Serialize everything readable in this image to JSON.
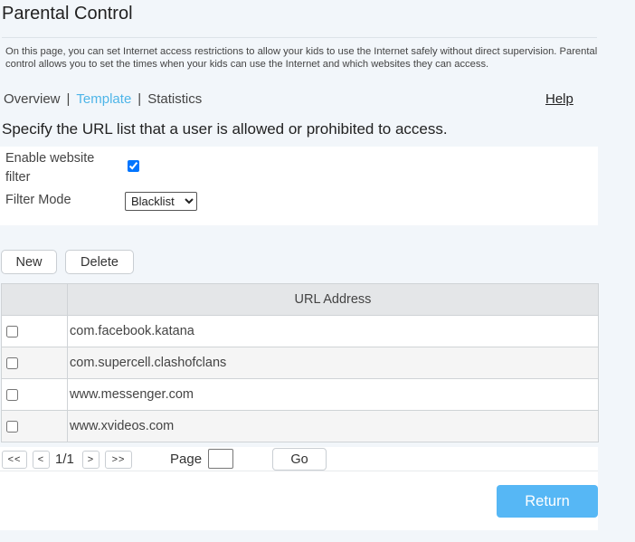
{
  "page": {
    "title": "Parental Control",
    "description": "On this page, you can set Internet access restrictions to allow your kids to use the Internet safely without direct supervision. Parental control allows you to set the times when your kids can use the Internet and which websites they can access."
  },
  "nav": {
    "tabs": [
      {
        "label": "Overview",
        "active": false
      },
      {
        "label": "Template",
        "active": true
      },
      {
        "label": "Statistics",
        "active": false
      }
    ],
    "separator": "|",
    "help_label": "Help"
  },
  "instruction": "Specify the URL list that a user is allowed or prohibited to access.",
  "filter": {
    "enable_label": "Enable website filter",
    "enabled": true,
    "mode_label": "Filter Mode",
    "mode_value": "Blacklist"
  },
  "toolbar": {
    "new_label": "New",
    "delete_label": "Delete"
  },
  "table": {
    "header_url": "URL Address",
    "rows": [
      {
        "url": "com.facebook.katana",
        "checked": false
      },
      {
        "url": "com.supercell.clashofclans",
        "checked": false
      },
      {
        "url": "www.messenger.com",
        "checked": false
      },
      {
        "url": "www.xvideos.com",
        "checked": false
      }
    ]
  },
  "pager": {
    "first_label": "<<",
    "prev_label": "<",
    "page_count": "1/1",
    "next_label": ">",
    "last_label": ">>",
    "page_label": "Page",
    "page_input_value": "",
    "go_label": "Go"
  },
  "footer": {
    "return_label": "Return"
  },
  "colors": {
    "accent": "#4eb5e8",
    "return_button": "#56b7f5",
    "background": "#f2f6fa"
  }
}
